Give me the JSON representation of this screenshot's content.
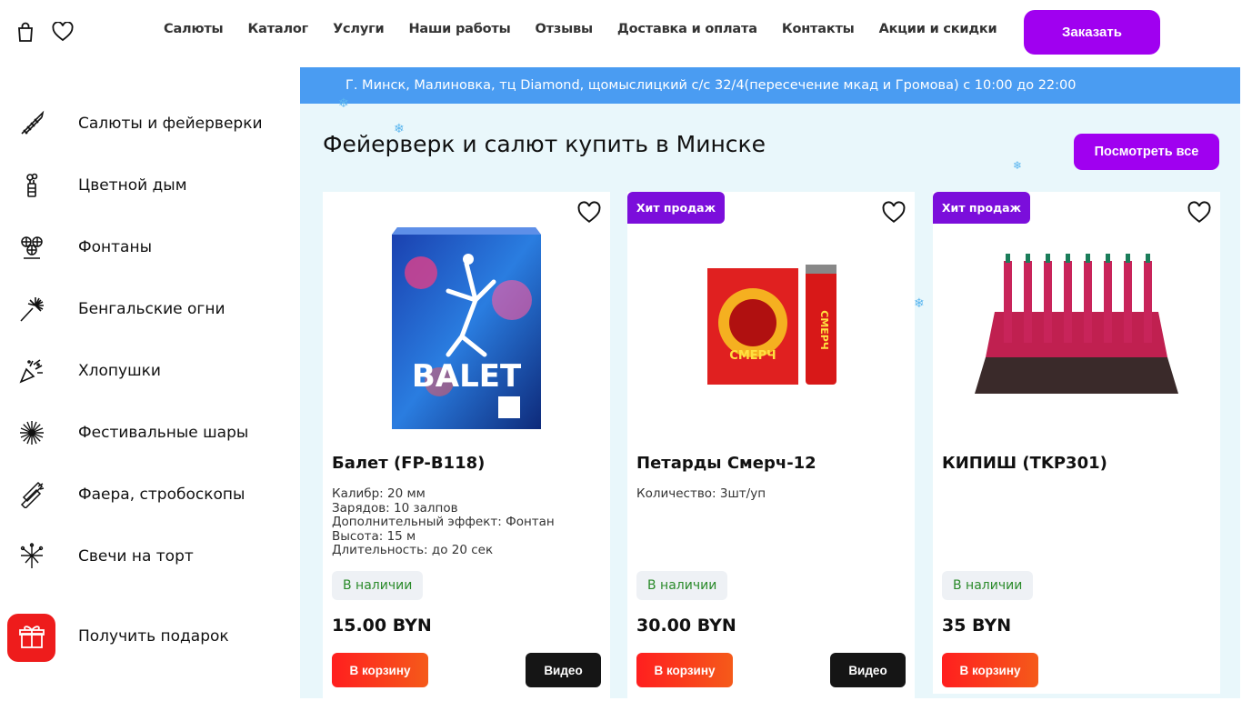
{
  "header": {
    "nav": [
      "Салюты",
      "Каталог",
      "Услуги",
      "Наши работы",
      "Отзывы",
      "Доставка и оплата",
      "Контакты",
      "Акции и скидки"
    ],
    "order_label": "Заказать"
  },
  "sidebar": {
    "items": [
      {
        "label": "Салюты и фейерверки",
        "icon": "rocket-icon"
      },
      {
        "label": "Цветной дым",
        "icon": "smoke-icon"
      },
      {
        "label": "Фонтаны",
        "icon": "fountain-icon"
      },
      {
        "label": "Бенгальские огни",
        "icon": "sparkler-icon"
      },
      {
        "label": "Хлопушки",
        "icon": "popper-icon"
      },
      {
        "label": "Фестивальные шары",
        "icon": "burst-icon"
      },
      {
        "label": "Фаера, стробоскопы",
        "icon": "flare-icon"
      },
      {
        "label": "Свечи на торт",
        "icon": "candle-icon"
      }
    ],
    "gift_label": "Получить подарок"
  },
  "main": {
    "address": "Г. Минск, Малиновка, тц Diamond, щомыслицкий с/с 32/4(пересечение мкад и Громова) с 10:00 до 22:00",
    "title": "Фейерверк и салют купить в Минске",
    "view_all": "Посмотреть все",
    "products": [
      {
        "badge": "",
        "name": "Балет (FP-B118)",
        "desc": [
          "Калибр: 20 мм",
          "Зарядов: 10 залпов",
          "Дополнительный эффект: Фонтан",
          "Высота: 15 м",
          "Длительность: до 20 сек"
        ],
        "stock": "В наличии",
        "price": "15.00 BYN",
        "cart": "В корзину",
        "video": "Видео"
      },
      {
        "badge": "Хит продаж",
        "name": "Петарды Смерч-12",
        "desc": [
          "Количество: 3шт/уп"
        ],
        "stock": "В наличии",
        "price": "30.00 BYN",
        "cart": "В корзину",
        "video": "Видео"
      },
      {
        "badge": "Хит продаж",
        "name": "КИПИШ (TKP301)",
        "desc": [],
        "stock": "В наличии",
        "price": "35 BYN",
        "cart": "В корзину",
        "video": ""
      }
    ]
  },
  "colors": {
    "accent": "#a000f0",
    "address_bar": "#4a9cf2",
    "cart": "#ff1f1f",
    "badge": "#7b0edb"
  }
}
